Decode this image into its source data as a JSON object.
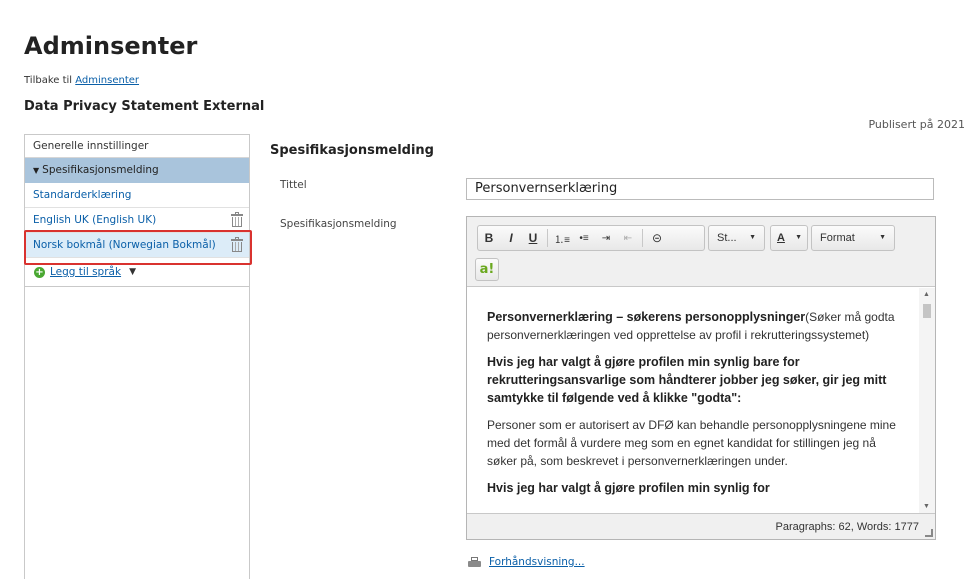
{
  "page": {
    "title": "Adminsenter",
    "back_prefix": "Tilbake til ",
    "back_link": "Adminsenter",
    "subtitle": "Data Privacy Statement External",
    "published": "Publisert på 2021"
  },
  "sidebar": {
    "general": "Generelle innstillinger",
    "section": "Spesifikasjonsmelding",
    "items": [
      {
        "label": "Standarderklæring"
      },
      {
        "label": "English UK (English UK)"
      },
      {
        "label": "Norsk bokmål (Norwegian Bokmål)"
      }
    ],
    "add_language": "Legg til språk"
  },
  "main": {
    "section_title": "Spesifikasjonsmelding",
    "title_label": "Tittel",
    "title_value": "Personvernserklæring",
    "message_label": "Spesifikasjonsmelding"
  },
  "editor": {
    "toolbar": {
      "bold": "B",
      "italic": "I",
      "underline": "U",
      "ordered_list": "⒈≡",
      "bullet_list": "•≡",
      "indent": "⇥",
      "outdent": "⇤",
      "link": "⊝",
      "styles": "St...",
      "font_color": "A",
      "format": "Format",
      "ai": "a!"
    },
    "content": {
      "p1_bold": "Personvernerklæring – søkerens personopplysninger",
      "p1_rest": "(Søker må godta personvernerklæringen ved opprettelse av profil i rekrutteringssystemet)",
      "p2": "Hvis jeg har valgt å gjøre profilen min synlig bare for rekrutteringsansvarlige som håndterer jobber jeg søker, gir jeg mitt samtykke til følgende ved å klikke \"godta\":",
      "p3": "Personer som er autorisert av DFØ kan behandle personopplysningene mine med det formål å vurdere meg som en egnet kandidat for stillingen jeg nå søker på, som beskrevet i personvernerklæringen under.",
      "p4": "Hvis jeg har valgt å gjøre profilen min synlig for"
    },
    "status": "Paragraphs: 62, Words: 1777"
  },
  "preview_link": "Forhåndsvisning..."
}
